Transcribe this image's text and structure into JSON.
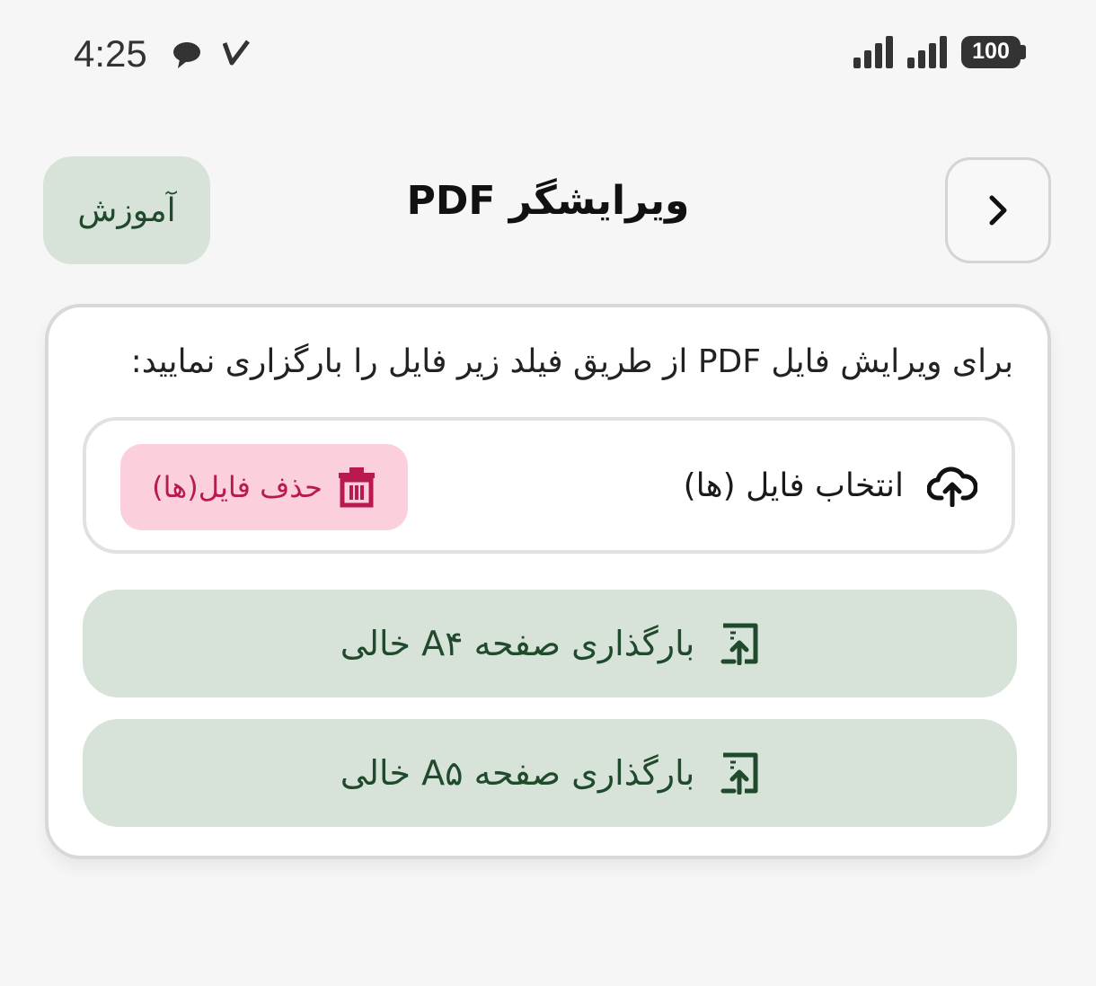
{
  "status_bar": {
    "time": "4:25",
    "battery": "100",
    "icons": [
      "chat-bubble-icon",
      "check-icon",
      "signal-icon",
      "signal-icon",
      "battery-icon"
    ]
  },
  "header": {
    "title": "ویرایشگر PDF",
    "help_label": "آموزش",
    "back_icon": "chevron-right-icon"
  },
  "card": {
    "instructions": "برای ویرایش فایل PDF از طریق فیلد زیر فایل را بارگزاری نمایید:",
    "file_picker": {
      "select_label": "انتخاب فایل (ها)",
      "select_icon": "cloud-upload-icon",
      "delete_label": "حذف فایل(ها)",
      "delete_icon": "trash-icon"
    },
    "actions": [
      {
        "label": "بارگذاری صفحه A۴ خالی",
        "icon": "page-upload-icon"
      },
      {
        "label": "بارگذاری صفحه A۵ خالی",
        "icon": "page-upload-icon"
      }
    ]
  },
  "colors": {
    "accent_green_bg": "#d7e2d8",
    "accent_green_text": "#1f4a2c",
    "danger_bg": "#fbd0dc",
    "danger_text": "#b8194f"
  }
}
